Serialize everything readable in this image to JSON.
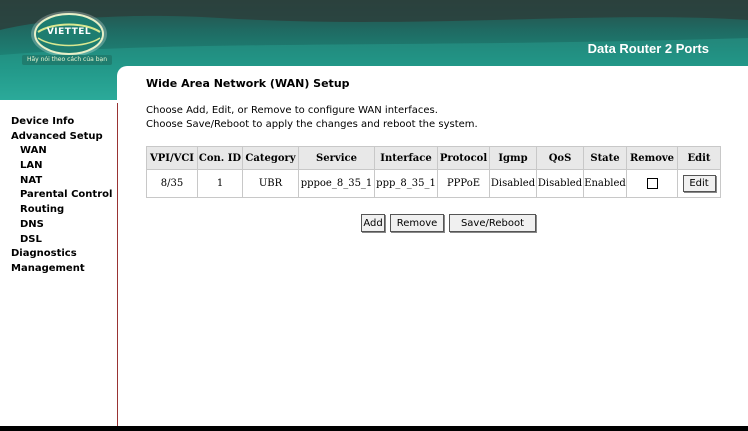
{
  "header": {
    "brand": "VIETTEL",
    "tagline": "Hãy nói theo cách của bạn",
    "product": "Data Router 2 Ports"
  },
  "sidebar": {
    "items": [
      {
        "label": "Device Info",
        "level": 0
      },
      {
        "label": "Advanced Setup",
        "level": 0
      },
      {
        "label": "WAN",
        "level": 1
      },
      {
        "label": "LAN",
        "level": 1
      },
      {
        "label": "NAT",
        "level": 1
      },
      {
        "label": "Parental Control",
        "level": 1
      },
      {
        "label": "Routing",
        "level": 1
      },
      {
        "label": "DNS",
        "level": 1
      },
      {
        "label": "DSL",
        "level": 1
      },
      {
        "label": "Diagnostics",
        "level": 0
      },
      {
        "label": "Management",
        "level": 0
      }
    ]
  },
  "main": {
    "title": "Wide Area Network (WAN) Setup",
    "desc1": "Choose Add, Edit, or Remove to configure WAN interfaces.",
    "desc2": "Choose Save/Reboot to apply the changes and reboot the system."
  },
  "table": {
    "headers": [
      "VPI/VCI",
      "Con. ID",
      "Category",
      "Service",
      "Interface",
      "Protocol",
      "Igmp",
      "QoS",
      "State",
      "Remove",
      "Edit"
    ],
    "rows": [
      {
        "vpi_vci": "8/35",
        "con_id": "1",
        "category": "UBR",
        "service": "pppoe_8_35_1",
        "interface": "ppp_8_35_1",
        "protocol": "PPPoE",
        "igmp": "Disabled",
        "qos": "Disabled",
        "state": "Enabled",
        "remove_checked": false,
        "edit_label": "Edit"
      }
    ]
  },
  "buttons": {
    "add": "Add",
    "remove": "Remove",
    "save_reboot": "Save/Reboot"
  },
  "colors": {
    "header_teal": "#1c8a7c",
    "sidebar_border": "#993333"
  }
}
